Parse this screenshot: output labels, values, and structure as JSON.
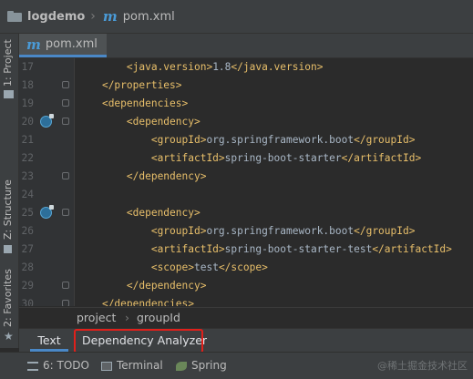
{
  "breadcrumb": {
    "project": "logdemo",
    "file": "pom.xml"
  },
  "left_stripe": {
    "project": "1: Project",
    "structure": "Z: Structure",
    "favorites": "2: Favorites"
  },
  "editor_tab": {
    "label": "pom.xml"
  },
  "lines": [
    {
      "num": "17",
      "indent": "        ",
      "parts": [
        [
          "tag",
          "<java.version>"
        ],
        [
          "txt",
          "1.8"
        ],
        [
          "tag",
          "</java.version>"
        ]
      ]
    },
    {
      "num": "18",
      "indent": "    ",
      "parts": [
        [
          "tag",
          "</properties>"
        ]
      ]
    },
    {
      "num": "19",
      "indent": "    ",
      "parts": [
        [
          "tag",
          "<dependencies>"
        ]
      ]
    },
    {
      "num": "20",
      "indent": "        ",
      "parts": [
        [
          "tag",
          "<dependency>"
        ]
      ]
    },
    {
      "num": "21",
      "indent": "            ",
      "parts": [
        [
          "tag",
          "<groupId>"
        ],
        [
          "txt",
          "org.springframework.boot"
        ],
        [
          "tag",
          "</groupId>"
        ]
      ]
    },
    {
      "num": "22",
      "indent": "            ",
      "parts": [
        [
          "tag",
          "<artifactId>"
        ],
        [
          "txt",
          "spring-boot-starter"
        ],
        [
          "tag",
          "</artifactId>"
        ]
      ]
    },
    {
      "num": "23",
      "indent": "        ",
      "parts": [
        [
          "tag",
          "</dependency>"
        ]
      ]
    },
    {
      "num": "24",
      "indent": "",
      "parts": []
    },
    {
      "num": "25",
      "indent": "        ",
      "parts": [
        [
          "tag",
          "<dependency>"
        ]
      ]
    },
    {
      "num": "26",
      "indent": "            ",
      "parts": [
        [
          "tag",
          "<groupId>"
        ],
        [
          "txt",
          "org.springframework.boot"
        ],
        [
          "tag",
          "</groupId>"
        ]
      ]
    },
    {
      "num": "27",
      "indent": "            ",
      "parts": [
        [
          "tag",
          "<artifactId>"
        ],
        [
          "txt",
          "spring-boot-starter-test"
        ],
        [
          "tag",
          "</artifactId>"
        ]
      ]
    },
    {
      "num": "28",
      "indent": "            ",
      "parts": [
        [
          "tag",
          "<scope>"
        ],
        [
          "txt",
          "test"
        ],
        [
          "tag",
          "</scope>"
        ]
      ]
    },
    {
      "num": "29",
      "indent": "        ",
      "parts": [
        [
          "tag",
          "</dependency>"
        ]
      ]
    },
    {
      "num": "30",
      "indent": "    ",
      "parts": [
        [
          "tag",
          "</dependencies>"
        ]
      ]
    }
  ],
  "gutter_markers": {
    "fold_lines": [
      "18",
      "19",
      "20",
      "23",
      "25",
      "29",
      "30"
    ],
    "icon_lines": [
      "20",
      "25"
    ]
  },
  "editor_breadcrumb": {
    "first": "project",
    "second": "groupId"
  },
  "subtabs": {
    "text": "Text",
    "dependency_analyzer": "Dependency Analyzer"
  },
  "bottom": {
    "todo": "6: TODO",
    "terminal": "Terminal",
    "spring": "Spring",
    "watermark": "@稀土掘金技术社区"
  },
  "colors": {
    "highlight_box": "#e0201b",
    "tag": "#e8bf6a",
    "accent": "#4a88c7"
  }
}
